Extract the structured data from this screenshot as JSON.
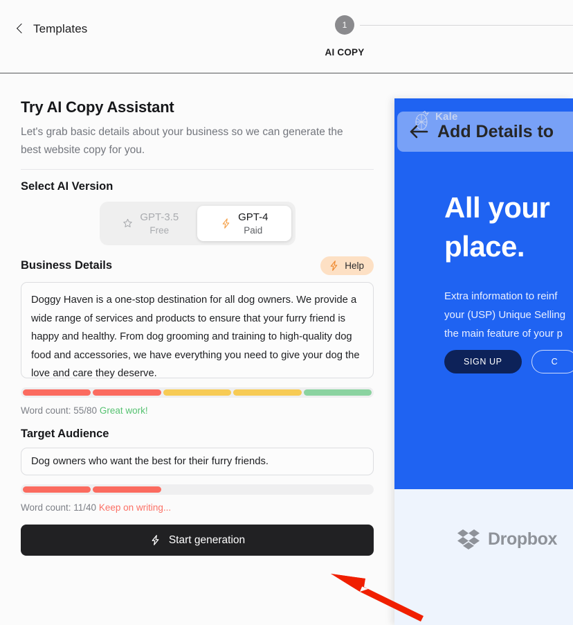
{
  "topbar": {
    "back_label": "Templates",
    "back_icon": "chevron-left-icon",
    "step_number": "1",
    "step_label": "AI COPY",
    "step_circle_color": "#8a8a8d"
  },
  "form": {
    "title": "Try AI Copy Assistant",
    "subtitle": "Let's grab basic details about your business so we can generate the best website copy for you.",
    "version_section_title": "Select AI Version",
    "models": [
      {
        "name": "GPT-3.5",
        "tier": "Free",
        "icon": "star-icon",
        "selected": false
      },
      {
        "name": "GPT-4",
        "tier": "Paid",
        "icon": "lightning-icon",
        "selected": true
      }
    ],
    "business": {
      "label": "Business Details",
      "help_label": "Help",
      "help_icon": "lightning-icon",
      "help_bg": "#fde0c4",
      "value": "Doggy Haven is a one-stop destination for all dog owners. We provide a wide range of services and products to ensure that your furry friend is happy and healthy. From dog grooming and training to high-quality dog food and accessories, we have everything you need to give your dog the love and care they deserve.",
      "meter_segments": [
        "#fb6b5f",
        "#fb6b5f",
        "#f7cb55",
        "#f7cb55",
        "#8bd3a0"
      ],
      "meter_total": 5,
      "word_count_label": "Word count: 55/80",
      "word_count_status": "Great work!",
      "word_count_status_color": "#56c271"
    },
    "audience": {
      "label": "Target Audience",
      "value": "Dog owners who want the best for their furry friends.",
      "meter_segments": [
        "#fb6b5f",
        "#fb6b5f"
      ],
      "meter_total": 5,
      "word_count_label": "Word count: 11/40",
      "word_count_status": "Keep on writing...",
      "word_count_status_color": "#fb7065"
    },
    "submit": {
      "label": "Start generation",
      "icon": "lightning-icon",
      "bg": "#212123"
    }
  },
  "preview": {
    "brand_name": "Kale",
    "brand_icon": "pineapple-icon",
    "overlay_title": "Add Details to",
    "overlay_back_icon": "arrow-left-icon",
    "headline": "All your\nplace.",
    "headline_line1": "All your",
    "headline_line2": "place.",
    "body_line1": "Extra information to reinf",
    "body_line2": "your (USP) Unique Selling",
    "body_line3": "the main feature of your p",
    "cta_primary": "SIGN UP",
    "cta_secondary": "C",
    "brand_bg": "#1f63f2",
    "logo_strip_bg": "#eef4fd",
    "logo_name": "Dropbox",
    "logo_icon": "dropbox-icon"
  },
  "annotation": {
    "arrow_color": "#f01f00",
    "arrow_name": "red-pointer-arrow"
  }
}
